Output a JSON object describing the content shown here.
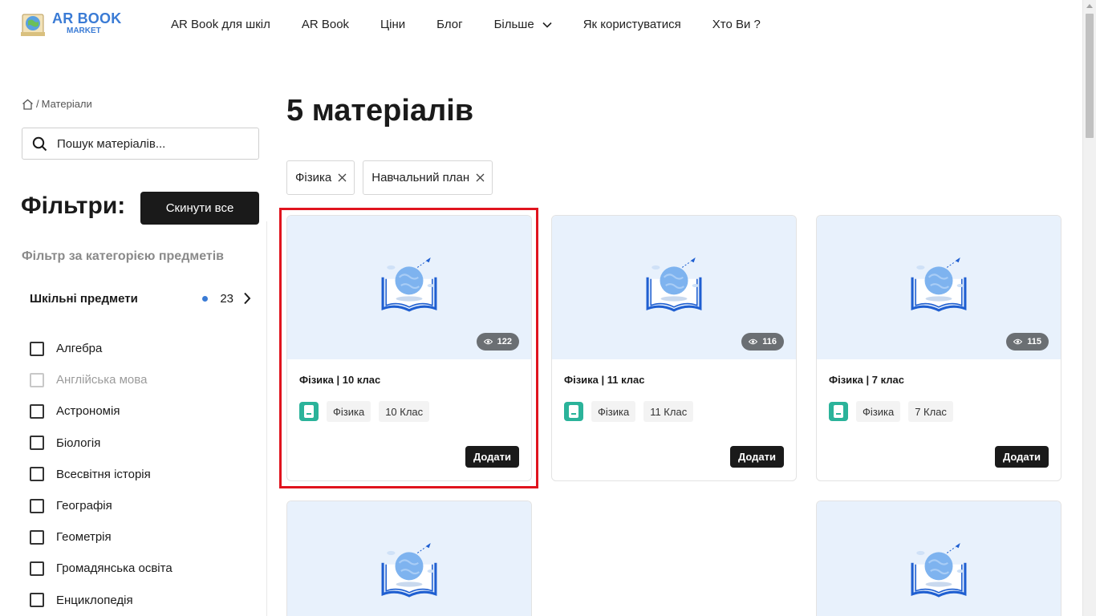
{
  "header": {
    "logo_line1": "AR BOOK",
    "logo_line2": "MARKET",
    "nav": [
      {
        "label": "AR Book для шкіл"
      },
      {
        "label": "AR Book"
      },
      {
        "label": "Ціни"
      },
      {
        "label": "Блог"
      },
      {
        "label": "Більше",
        "has_dropdown": true
      },
      {
        "label": "Як користуватися"
      },
      {
        "label": "Хто Ви ?"
      }
    ]
  },
  "sidebar": {
    "breadcrumb_sep": "/",
    "breadcrumb_current": "Матеріали",
    "search_placeholder": "Пошук матеріалів...",
    "filters_title": "Фільтри:",
    "reset_label": "Скинути все",
    "category_title": "Фільтр за категорією предметів",
    "school_subjects": {
      "label": "Шкільні предмети",
      "count": "23"
    },
    "subjects": [
      {
        "label": "Алгебра",
        "disabled": false
      },
      {
        "label": "Англійська мова",
        "disabled": true
      },
      {
        "label": "Астрономія",
        "disabled": false
      },
      {
        "label": "Біологія",
        "disabled": false
      },
      {
        "label": "Всесвітня історія",
        "disabled": false
      },
      {
        "label": "Географія",
        "disabled": false
      },
      {
        "label": "Геометрія",
        "disabled": false
      },
      {
        "label": "Громадянська освіта",
        "disabled": false
      },
      {
        "label": "Енциклопедія",
        "disabled": false
      }
    ]
  },
  "main": {
    "title": "5 матеріалів",
    "active_filters": [
      "Фізика",
      "Навчальний план"
    ],
    "cards": [
      {
        "title": "Фізика | 10 клас",
        "views": "122",
        "subject": "Фізика",
        "grade": "10 Клас",
        "add_label": "Додати"
      },
      {
        "title": "Фізика | 11 клас",
        "views": "116",
        "subject": "Фізика",
        "grade": "11 Клас",
        "add_label": "Додати"
      },
      {
        "title": "Фізика | 7 клас",
        "views": "115",
        "subject": "Фізика",
        "grade": "7 Клас",
        "add_label": "Додати"
      }
    ]
  },
  "colors": {
    "accent": "#3a7bd5",
    "dark": "#1a1a1a",
    "card_bg": "#e8f1fc",
    "highlight": "#e0141e",
    "tag_icon": "#2bb39a"
  }
}
